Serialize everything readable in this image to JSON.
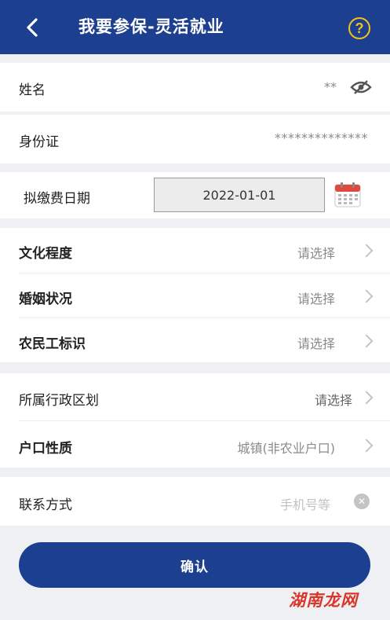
{
  "header": {
    "title": "我要参保-灵活就业",
    "help_symbol": "?"
  },
  "personal": {
    "name_label": "姓名",
    "name_value": "**",
    "id_label": "身份证",
    "id_value": "**************"
  },
  "payment": {
    "date_label": "拟缴费日期",
    "date_value": "2022-01-01"
  },
  "profile": {
    "education_label": "文化程度",
    "education_value": "请选择",
    "marriage_label": "婚姻状况",
    "marriage_value": "请选择",
    "migrant_label": "农民工标识",
    "migrant_value": "请选择"
  },
  "household": {
    "region_label": "所属行政区划",
    "region_value": "请选择",
    "hukou_label": "户口性质",
    "hukou_value": "城镇(非农业户口)"
  },
  "contact": {
    "label": "联系方式",
    "placeholder": "手机号等"
  },
  "confirm_label": "确认",
  "watermark": "湖南龙网",
  "colors": {
    "primary": "#1d3f8f",
    "help": "#f4c21c",
    "watermark": "#d9372b"
  }
}
